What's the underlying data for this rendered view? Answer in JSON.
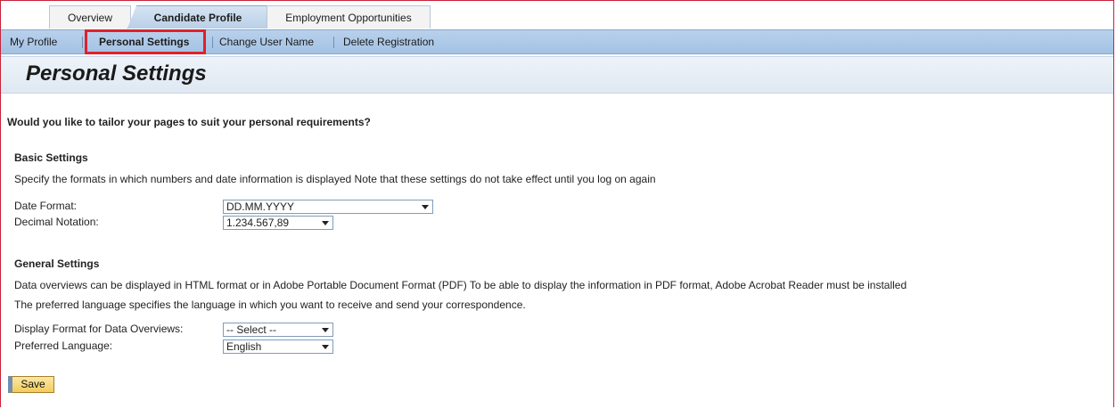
{
  "tabs": {
    "overview": "Overview",
    "candidate_profile": "Candidate Profile",
    "employment_opportunities": "Employment Opportunities"
  },
  "subnav": {
    "my_profile": "My Profile",
    "personal_settings": "Personal Settings",
    "change_user_name": "Change User Name",
    "delete_registration": "Delete Registration"
  },
  "page_title": "Personal Settings",
  "intro_question": "Would you like to tailor your pages to suit your personal requirements?",
  "basic": {
    "heading": "Basic Settings",
    "description": "Specify the formats in which numbers and date information is displayed Note that these settings do not take effect until you log on again",
    "date_format_label": "Date Format:",
    "date_format_value": "DD.MM.YYYY",
    "decimal_label": "Decimal Notation:",
    "decimal_value": "1.234.567,89"
  },
  "general": {
    "heading": "General Settings",
    "description1": "Data overviews can be displayed in HTML format or in Adobe Portable Document Format (PDF) To be able to display the information in PDF format, Adobe Acrobat Reader must be installed",
    "description2": "The preferred language specifies the language in which you want to receive and send your correspondence.",
    "display_format_label": "Display Format for Data Overviews:",
    "display_format_value": "-- Select --",
    "language_label": "Preferred Language:",
    "language_value": "English"
  },
  "save_label": "Save",
  "colors": {
    "accent_blue": "#a4c2e4",
    "highlight_red": "#e0202b",
    "save_yellow": "#f3cc5a"
  }
}
